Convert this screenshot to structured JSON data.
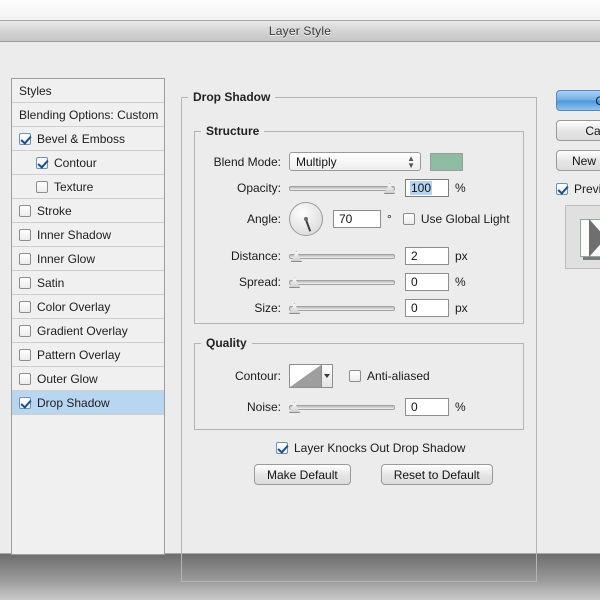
{
  "window": {
    "title": "Layer Style"
  },
  "styles_panel": {
    "items": [
      {
        "label": "Styles",
        "checkbox": "none",
        "indent": false,
        "selected": false
      },
      {
        "label": "Blending Options: Custom",
        "checkbox": "none",
        "indent": false,
        "selected": false
      },
      {
        "label": "Bevel & Emboss",
        "checkbox": "checked",
        "indent": false,
        "selected": false
      },
      {
        "label": "Contour",
        "checkbox": "checked",
        "indent": true,
        "selected": false
      },
      {
        "label": "Texture",
        "checkbox": "unchecked",
        "indent": true,
        "selected": false
      },
      {
        "label": "Stroke",
        "checkbox": "unchecked",
        "indent": false,
        "selected": false
      },
      {
        "label": "Inner Shadow",
        "checkbox": "unchecked",
        "indent": false,
        "selected": false
      },
      {
        "label": "Inner Glow",
        "checkbox": "unchecked",
        "indent": false,
        "selected": false
      },
      {
        "label": "Satin",
        "checkbox": "unchecked",
        "indent": false,
        "selected": false
      },
      {
        "label": "Color Overlay",
        "checkbox": "unchecked",
        "indent": false,
        "selected": false
      },
      {
        "label": "Gradient Overlay",
        "checkbox": "unchecked",
        "indent": false,
        "selected": false
      },
      {
        "label": "Pattern Overlay",
        "checkbox": "unchecked",
        "indent": false,
        "selected": false
      },
      {
        "label": "Outer Glow",
        "checkbox": "unchecked",
        "indent": false,
        "selected": false
      },
      {
        "label": "Drop Shadow",
        "checkbox": "checked",
        "indent": false,
        "selected": true
      }
    ]
  },
  "main_panel": {
    "title": "Drop Shadow",
    "structure": {
      "title": "Structure",
      "blend_mode": {
        "label": "Blend Mode:",
        "value": "Multiply",
        "color_swatch": "#8fbda4"
      },
      "opacity": {
        "label": "Opacity:",
        "value": "100",
        "unit": "%",
        "slider_pct": 100
      },
      "angle": {
        "label": "Angle:",
        "value": "70",
        "unit": "°",
        "degrees": 70
      },
      "use_global_light": {
        "label": "Use Global Light",
        "checked": false
      },
      "distance": {
        "label": "Distance:",
        "value": "2",
        "unit": "px",
        "slider_pct": 2
      },
      "spread": {
        "label": "Spread:",
        "value": "0",
        "unit": "%",
        "slider_pct": 0
      },
      "size": {
        "label": "Size:",
        "value": "0",
        "unit": "px",
        "slider_pct": 0
      }
    },
    "quality": {
      "title": "Quality",
      "contour": {
        "label": "Contour:"
      },
      "anti_aliased": {
        "label": "Anti-aliased",
        "checked": false
      },
      "noise": {
        "label": "Noise:",
        "value": "0",
        "unit": "%",
        "slider_pct": 0
      }
    },
    "knockout": {
      "label": "Layer Knocks Out Drop Shadow",
      "checked": true
    },
    "make_default_label": "Make Default",
    "reset_default_label": "Reset to Default"
  },
  "actions": {
    "ok_label": "OK",
    "cancel_label": "Cancel",
    "new_style_label": "New Style...",
    "preview_label": "Preview",
    "preview_checked": true
  }
}
